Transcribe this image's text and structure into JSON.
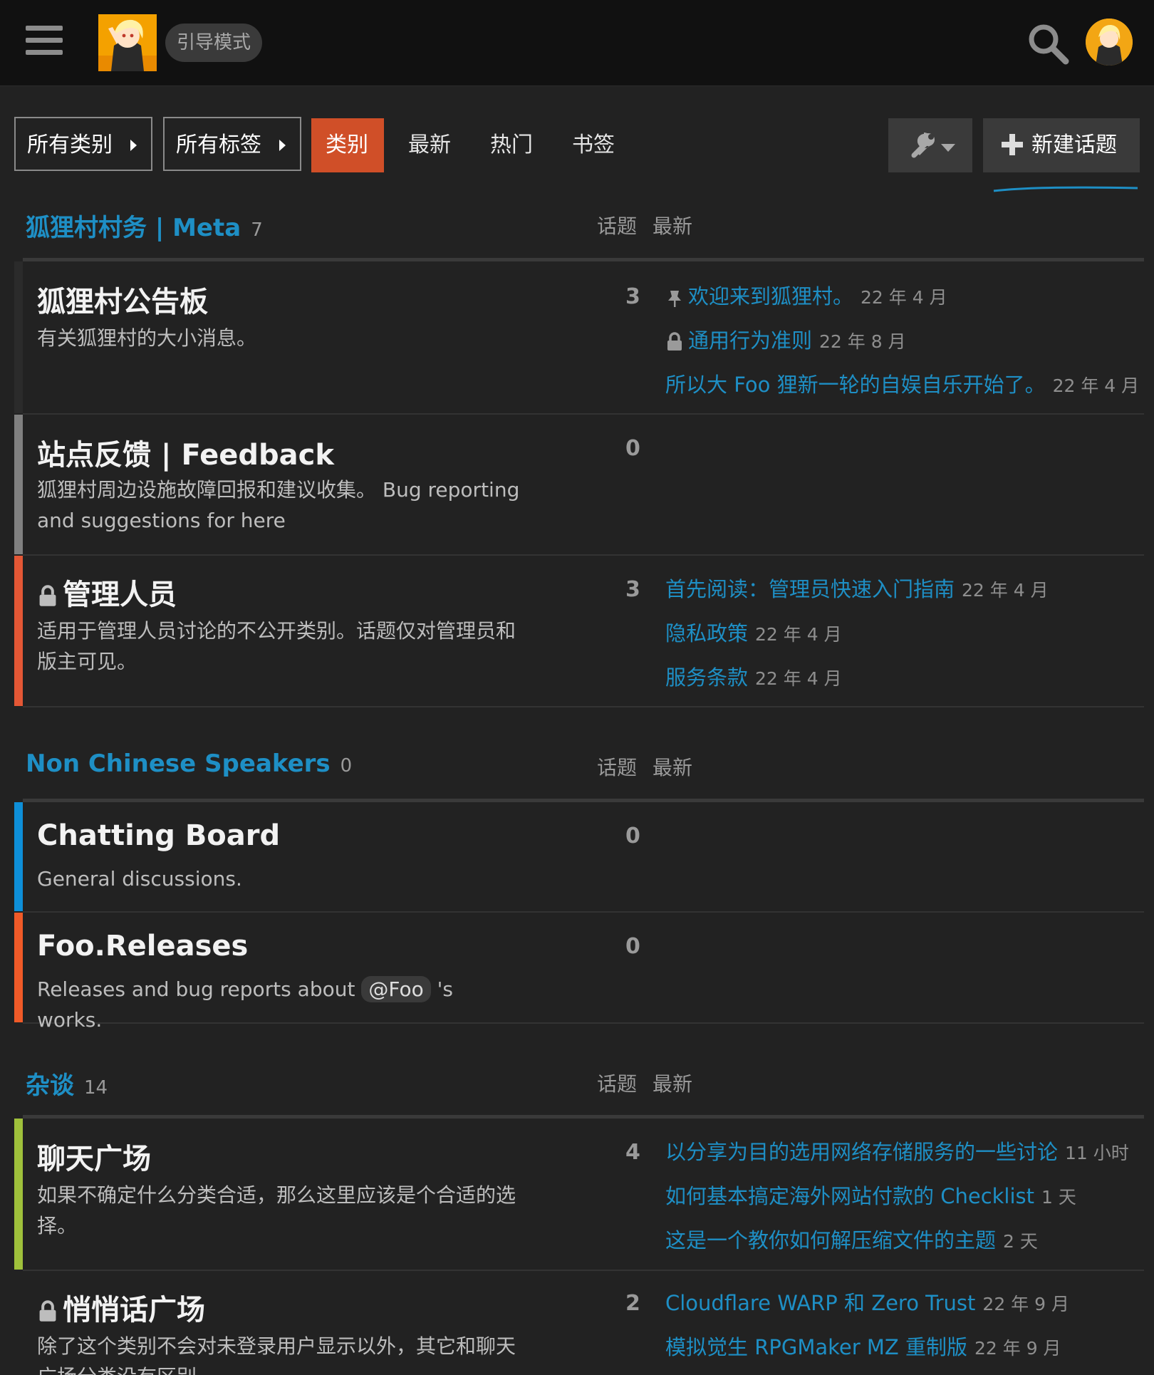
{
  "header": {
    "guide_badge": "引导模式"
  },
  "nav": {
    "categories_dropdown": "所有类别",
    "tags_dropdown": "所有标签",
    "tabs": [
      "类别",
      "最新",
      "热门",
      "书签"
    ],
    "new_topic_label": "新建话题"
  },
  "columns": {
    "topics": "话题",
    "latest": "最新"
  },
  "colors": {
    "accent": "#1e8fc5",
    "active_tab": "#d04f28",
    "meta_bar": "#2b2b2b",
    "feedback_bar": "#808080",
    "staff_bar": "#e45735",
    "chat_bar": "#0e8fd8",
    "releases_bar": "#f05a28",
    "misc_bar": "#9fc13b"
  },
  "sections": [
    {
      "title": "狐狸村村务 | Meta",
      "count": "7",
      "categories": [
        {
          "name": "狐狸村公告板",
          "description": "有关狐狸村的大小消息。",
          "topic_count": "3",
          "topics": [
            {
              "icon": "pin-icon",
              "title": "欢迎来到狐狸村。",
              "age": "22 年 4 月"
            },
            {
              "icon": "lock-icon",
              "title": "通用行为准则",
              "age": "22 年 8 月"
            },
            {
              "icon": "",
              "title": "所以大 Foo 狸新一轮的自娱自乐开始了。",
              "age": "22 年 4 月"
            }
          ]
        },
        {
          "name": "站点反馈 | Feedback",
          "description": "狐狸村周边设施故障回报和建议收集。 Bug reporting and suggestions for here",
          "topic_count": "0",
          "topics": []
        },
        {
          "name": "管理人员",
          "description": "适用于管理人员讨论的不公开类别。话题仅对管理员和版主可见。",
          "topic_count": "3",
          "topics": [
            {
              "icon": "",
              "title": "首先阅读：管理员快速入门指南",
              "age": "22 年 4 月"
            },
            {
              "icon": "",
              "title": "隐私政策",
              "age": "22 年 4 月"
            },
            {
              "icon": "",
              "title": "服务条款",
              "age": "22 年 4 月"
            }
          ]
        }
      ]
    },
    {
      "title": "Non Chinese Speakers",
      "count": "0",
      "categories": [
        {
          "name": "Chatting Board",
          "description": "General discussions.",
          "topic_count": "0",
          "topics": []
        },
        {
          "name": "Foo.Releases",
          "description_before": "Releases and bug reports about",
          "mention": "@Foo",
          "description_after": "'s works.",
          "topic_count": "0",
          "topics": []
        }
      ]
    },
    {
      "title": "杂谈",
      "count": "14",
      "categories": [
        {
          "name": "聊天广场",
          "description": "如果不确定什么分类合适，那么这里应该是个合适的选择。",
          "topic_count": "4",
          "topics": [
            {
              "icon": "",
              "title": "以分享为目的选用网络存储服务的一些讨论",
              "age": "11 小时"
            },
            {
              "icon": "",
              "title": "如何基本搞定海外网站付款的 Checklist",
              "age": "1 天"
            },
            {
              "icon": "",
              "title": "这是一个教你如何解压缩文件的主题",
              "age": "2 天"
            }
          ]
        },
        {
          "name": "悄悄话广场",
          "description": "除了这个类别不会对未登录用户显示以外，其它和聊天广场分类没有区别",
          "topic_count": "2",
          "topics": [
            {
              "icon": "",
              "title": "Cloudflare WARP 和 Zero Trust",
              "age": "22 年 9 月"
            },
            {
              "icon": "",
              "title": "模拟觉生 RPGMaker MZ 重制版",
              "age": "22 年 9 月"
            }
          ]
        }
      ]
    }
  ]
}
